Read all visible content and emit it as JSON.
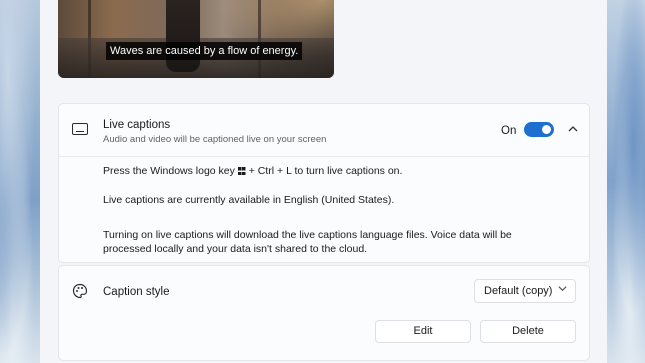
{
  "preview": {
    "caption": "Waves are caused by a flow of energy."
  },
  "live_captions": {
    "title": "Live captions",
    "subtitle": "Audio and video will be captioned live on your screen",
    "state_label": "On",
    "toggle_on": true,
    "accent_color": "#1f6fd1",
    "icons": [
      "captions-icon",
      "chevron-up-icon"
    ],
    "shortcut_before": "Press the Windows logo key",
    "shortcut_after": "+ Ctrl + L to turn live captions on.",
    "availability": "Live captions are currently available in English (United States).",
    "download_note_line1": "Turning on live captions will download the live captions language files. Voice data will be",
    "download_note_line2": "processed locally and your data isn't shared to the cloud."
  },
  "caption_style": {
    "title": "Caption style",
    "selected_style": "Default (copy)",
    "edit_label": "Edit",
    "delete_label": "Delete",
    "icons": [
      "palette-icon",
      "chevron-down-icon"
    ]
  }
}
